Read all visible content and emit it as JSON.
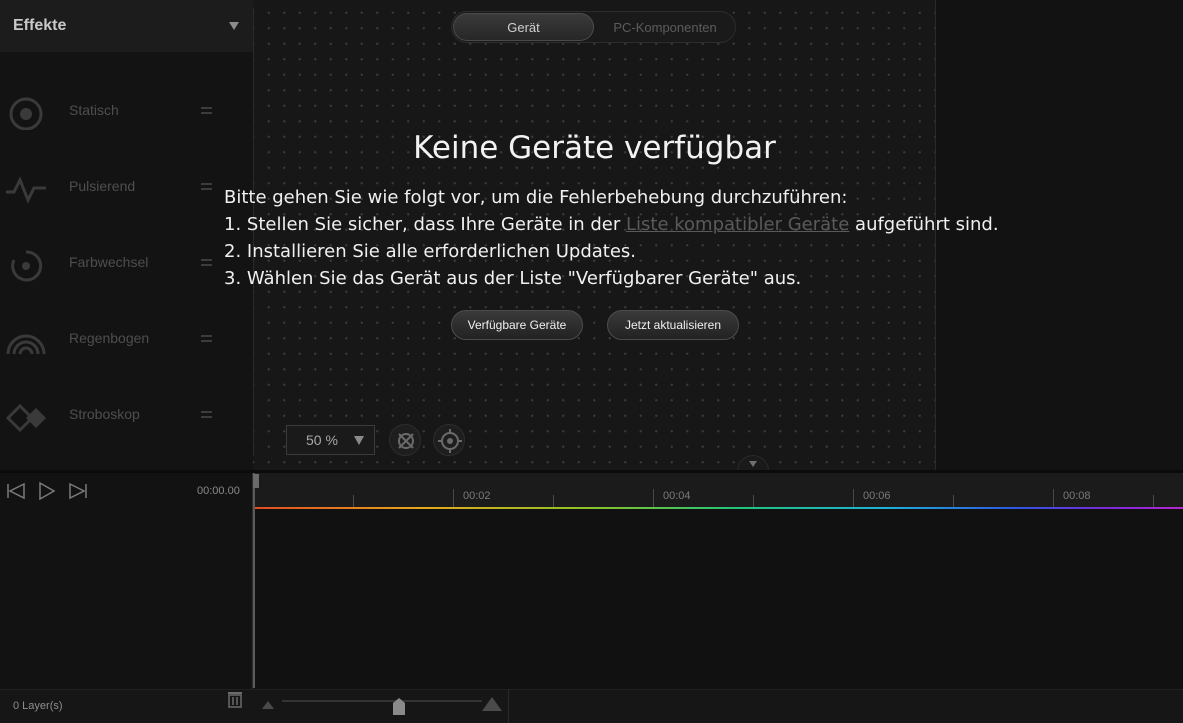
{
  "sidebar": {
    "title": "Effekte",
    "items": [
      {
        "label": "Statisch",
        "icon": "static-icon"
      },
      {
        "label": "Pulsierend",
        "icon": "pulse-icon"
      },
      {
        "label": "Farbwechsel",
        "icon": "color-cycle-icon"
      },
      {
        "label": "Regenbogen",
        "icon": "rainbow-icon"
      },
      {
        "label": "Stroboskop",
        "icon": "strobe-icon"
      }
    ]
  },
  "canvas": {
    "tabs": [
      {
        "label": "Gerät",
        "active": true
      },
      {
        "label": "PC-Komponenten",
        "active": false
      }
    ],
    "no_devices": {
      "title": "Keine Geräte verfügbar",
      "intro": "Bitte gehen Sie wie folgt vor, um die Fehlerbehebung durchzuführen:",
      "step1_before": "1. Stellen Sie sicher, dass Ihre Geräte in der ",
      "step1_link": "Liste kompatibler Geräte",
      "step1_after": " aufgeführt sind.",
      "step2": "2. Installieren Sie alle erforderlichen Updates.",
      "step3": "3. Wählen Sie das Gerät aus der Liste \"Verfügbarer Geräte\" aus."
    },
    "buttons": {
      "available_devices": "Verfügbare Geräte",
      "update_now": "Jetzt aktualisieren"
    },
    "zoom": "50 %"
  },
  "timeline": {
    "timecode": "00:00.00",
    "ticks": [
      "00:02",
      "00:04",
      "00:06",
      "00:08"
    ],
    "layers": "0  Layer(s)"
  },
  "colors": {
    "background": "#111111",
    "text": "#f0f0f0",
    "muted": "#4e4e4e"
  }
}
